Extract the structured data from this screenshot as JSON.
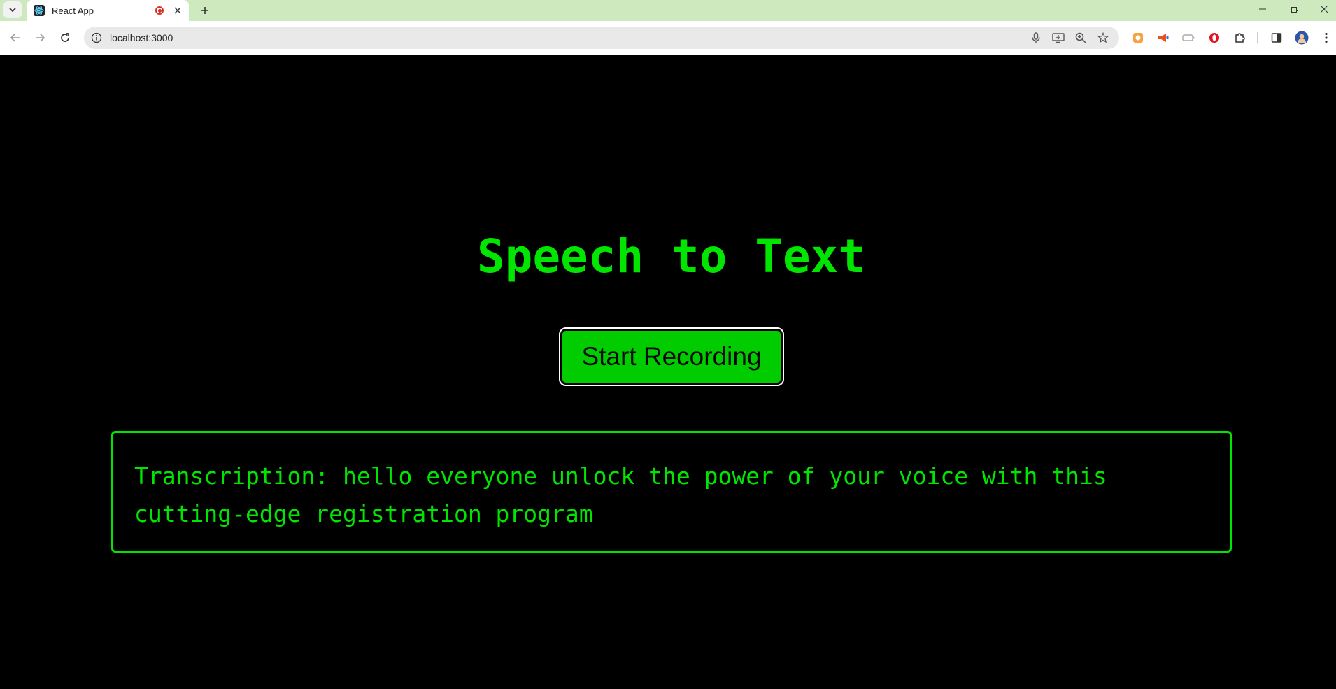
{
  "browser": {
    "tab_title": "React App",
    "url": "localhost:3000"
  },
  "app": {
    "title": "Speech to Text",
    "record_button_label": "Start Recording",
    "transcription_prefix": "Transcription:",
    "transcription_text": "hello everyone unlock the power of your voice with this cutting-edge registration program"
  },
  "colors": {
    "accent": "#00e600",
    "button_bg": "#00cc00",
    "page_bg": "#000000",
    "tabbar_bg": "#cde9bd"
  }
}
